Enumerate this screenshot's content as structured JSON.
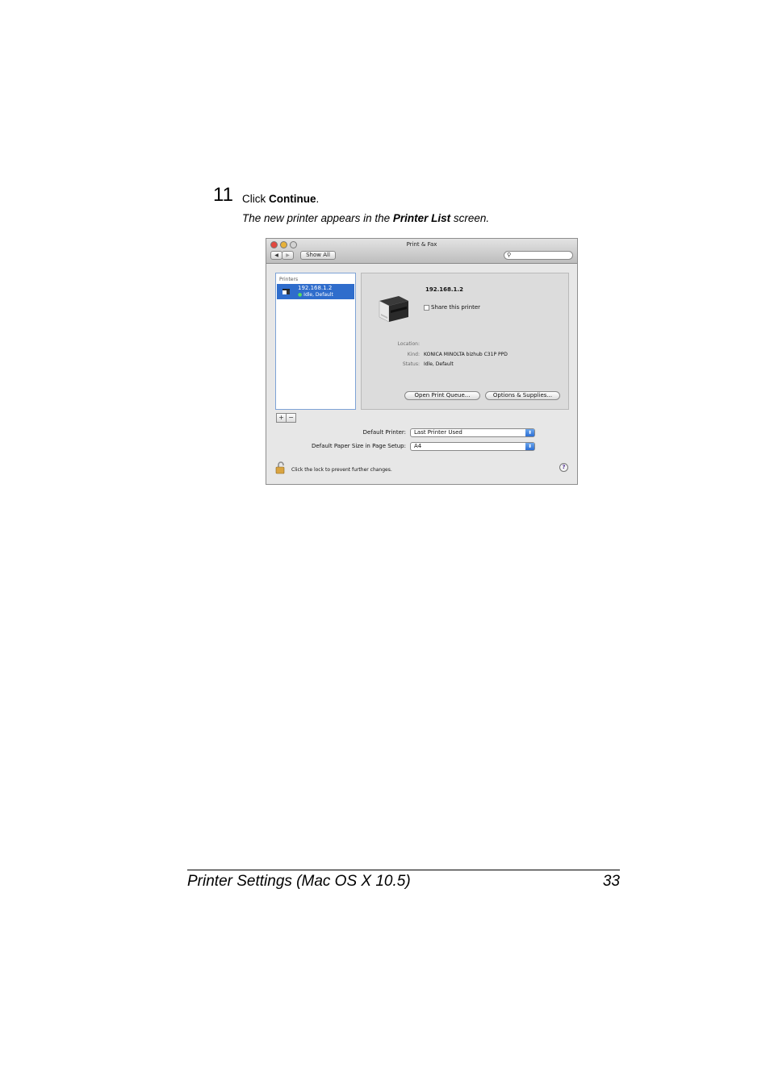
{
  "step": {
    "number": "11",
    "text_prefix": "Click ",
    "text_bold": "Continue",
    "text_suffix": ".",
    "note_prefix": "The new printer appears in the ",
    "note_bold": "Printer List",
    "note_suffix": " screen."
  },
  "window": {
    "title": "Print & Fax",
    "show_all": "Show All",
    "nav_back": "◀",
    "nav_forward": "▶",
    "printers_header": "Printers",
    "printer_item": {
      "name": "192.168.1.2",
      "status_dot": "●",
      "status": "Idle, Default"
    },
    "detail": {
      "name": "192.168.1.2",
      "share_label": "Share this printer",
      "location_label": "Location:",
      "location_value": "",
      "kind_label": "Kind:",
      "kind_value": "KONICA MINOLTA bizhub C31P PPD",
      "status_label": "Status:",
      "status_value": "Idle, Default",
      "open_queue": "Open Print Queue...",
      "options_supplies": "Options & Supplies..."
    },
    "add": "+",
    "remove": "−",
    "default_printer_label": "Default Printer:",
    "default_printer_value": "Last Printer Used",
    "paper_size_label": "Default Paper Size in Page Setup:",
    "paper_size_value": "A4",
    "popup_arrow": "⬍",
    "lock_text": "Click the lock to prevent further changes.",
    "help": "?"
  },
  "footer": {
    "title": "Printer Settings (Mac OS X 10.5)",
    "page": "33"
  }
}
